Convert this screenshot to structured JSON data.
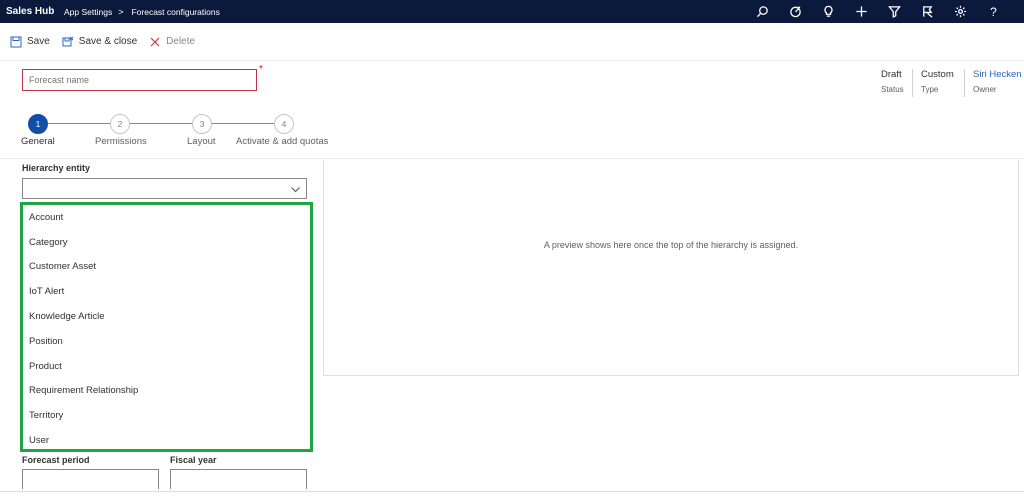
{
  "topbar": {
    "app_name": "Sales Hub",
    "breadcrumb": [
      "App Settings",
      "Forecast configurations"
    ],
    "separator": ">",
    "icons": [
      "search-icon",
      "target-icon",
      "lightbulb-icon",
      "plus-icon",
      "filter-icon",
      "person-pin-icon",
      "gear-icon",
      "help-icon"
    ],
    "help_glyph": "?"
  },
  "toolbar": {
    "save_label": "Save",
    "save_close_label": "Save & close",
    "delete_label": "Delete"
  },
  "form": {
    "name_placeholder": "Forecast name",
    "required_marker": "*"
  },
  "header_meta": {
    "status_value": "Draft",
    "status_label": "Status",
    "type_value": "Custom",
    "type_label": "Type",
    "owner_value": "Siri Hecken",
    "owner_label": "Owner"
  },
  "stepper": {
    "steps": [
      {
        "number": "1",
        "label": "General"
      },
      {
        "number": "2",
        "label": "Permissions"
      },
      {
        "number": "3",
        "label": "Layout"
      },
      {
        "number": "4",
        "label": "Activate & add quotas"
      }
    ],
    "active_step": "1"
  },
  "hierarchy": {
    "label": "Hierarchy entity",
    "options": [
      "Account",
      "Category",
      "Customer Asset",
      "IoT Alert",
      "Knowledge Article",
      "Position",
      "Product",
      "Requirement Relationship",
      "Territory",
      "User"
    ]
  },
  "preview": {
    "message": "A preview shows here once the top of the hierarchy is assigned."
  },
  "lower_fields": {
    "forecast_period_label": "Forecast period",
    "fiscal_year_label": "Fiscal year"
  },
  "colors": {
    "nav_bg": "#0b1a3c",
    "accent": "#0f4fa8",
    "error_border": "#c4314b",
    "highlight": "#21a446",
    "link": "#2b66c4"
  }
}
